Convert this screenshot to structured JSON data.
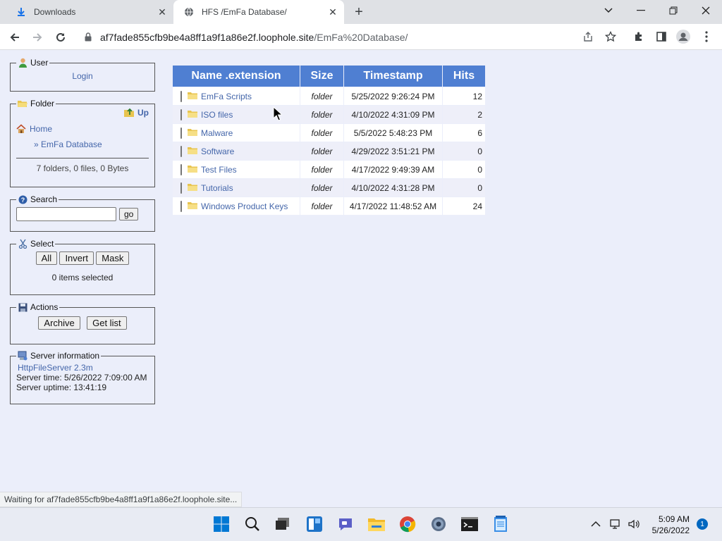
{
  "browser": {
    "tabs": [
      {
        "title": "Downloads",
        "active": false
      },
      {
        "title": "HFS /EmFa Database/",
        "active": true
      }
    ],
    "url_host": "af7fade855cfb9be4a8ff1a9f1a86e2f.loophole.site",
    "url_path": "/EmFa%20Database/",
    "status_text": "Waiting for af7fade855cfb9be4a8ff1a9f1a86e2f.loophole.site..."
  },
  "sidebar": {
    "user": {
      "legend": "User",
      "login_label": "Login"
    },
    "folder": {
      "legend": "Folder",
      "up_label": "Up",
      "home_label": "Home",
      "current_label": "» EmFa Database",
      "summary": "7 folders, 0 files, 0 Bytes"
    },
    "search": {
      "legend": "Search",
      "value": "",
      "go_label": "go"
    },
    "select": {
      "legend": "Select",
      "all_label": "All",
      "invert_label": "Invert",
      "mask_label": "Mask",
      "selected_text": "0 items selected"
    },
    "actions": {
      "legend": "Actions",
      "archive_label": "Archive",
      "getlist_label": "Get list"
    },
    "server": {
      "legend": "Server information",
      "version_link": "HttpFileServer 2.3m",
      "server_time": "Server time: 5/26/2022 7:09:00 AM",
      "server_uptime": "Server uptime: 13:41:19"
    }
  },
  "files": {
    "headers": {
      "name": "Name .extension",
      "size": "Size",
      "timestamp": "Timestamp",
      "hits": "Hits"
    },
    "rows": [
      {
        "name": "EmFa Scripts",
        "size": "folder",
        "timestamp": "5/25/2022 9:26:24 PM",
        "hits": "12"
      },
      {
        "name": "ISO files",
        "size": "folder",
        "timestamp": "4/10/2022 4:31:09 PM",
        "hits": "2"
      },
      {
        "name": "Malware",
        "size": "folder",
        "timestamp": "5/5/2022 5:48:23 PM",
        "hits": "6"
      },
      {
        "name": "Software",
        "size": "folder",
        "timestamp": "4/29/2022 3:51:21 PM",
        "hits": "0"
      },
      {
        "name": "Test Files",
        "size": "folder",
        "timestamp": "4/17/2022 9:49:39 AM",
        "hits": "0"
      },
      {
        "name": "Tutorials",
        "size": "folder",
        "timestamp": "4/10/2022 4:31:28 PM",
        "hits": "0"
      },
      {
        "name": "Windows Product Keys",
        "size": "folder",
        "timestamp": "4/17/2022 11:48:52 AM",
        "hits": "24"
      }
    ]
  },
  "taskbar": {
    "time": "5:09 AM",
    "date": "5/26/2022",
    "notification_count": "1"
  },
  "colors": {
    "header_blue": "#4f7fd2",
    "page_bg": "#ebeefa",
    "link": "#4466aa"
  }
}
